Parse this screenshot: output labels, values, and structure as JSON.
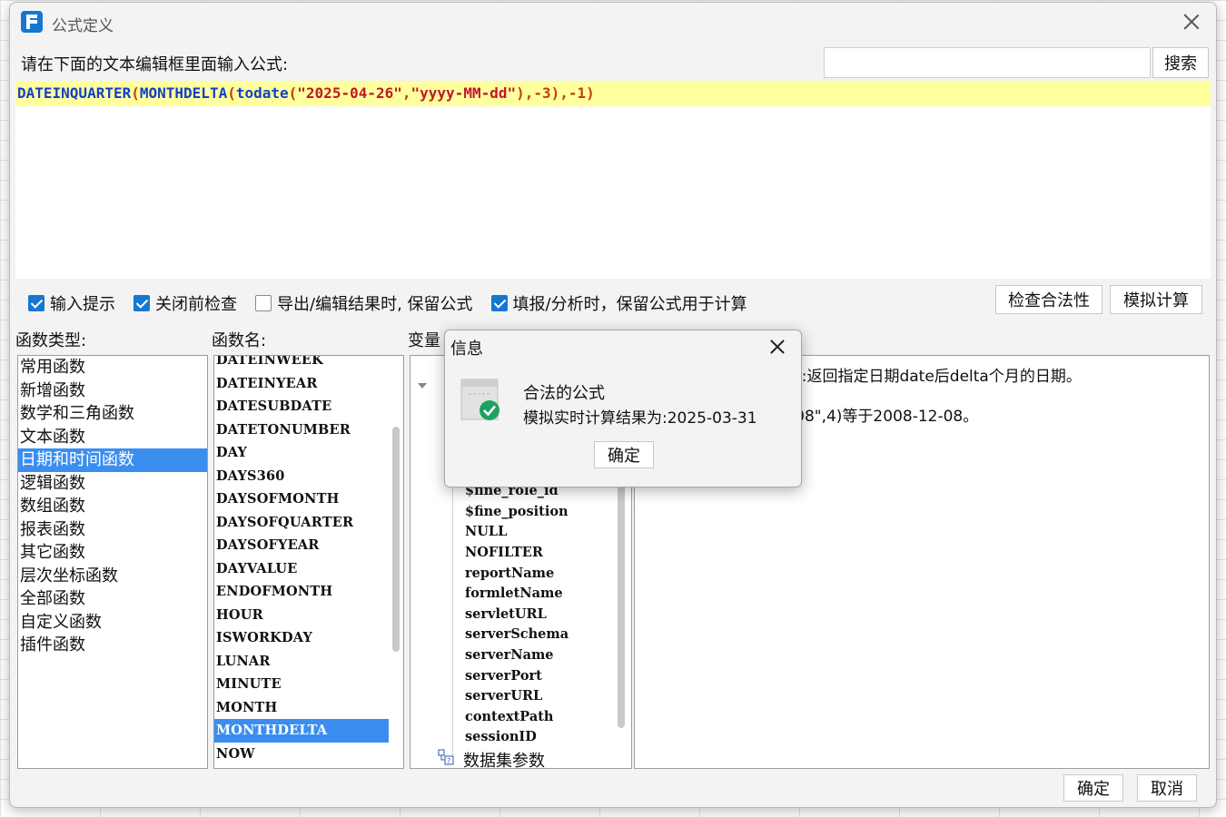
{
  "window": {
    "title": "公式定义",
    "close_label": "×"
  },
  "header": {
    "prompt": "请在下面的文本编辑框里面输入公式:",
    "search_placeholder": "",
    "search_button": "搜索"
  },
  "formula": {
    "text": "DATEINQUARTER(MONTHDELTA(todate(\"2025-04-26\",\"yyyy-MM-dd\"),-3),-1)",
    "tokens": {
      "f1": "DATEINQUARTER",
      "p1": "(",
      "f2": "MONTHDELTA",
      "p2": "(",
      "f3": "todate",
      "p3": "(",
      "s1": "\"2025-04-26\"",
      "c1": ",",
      "s2": "\"yyyy-MM-dd\"",
      "r1": "),-3),-1)"
    }
  },
  "options": [
    {
      "label": "输入提示",
      "checked": true
    },
    {
      "label": "关闭前检查",
      "checked": true
    },
    {
      "label": "导出/编辑结果时, 保留公式",
      "checked": false
    },
    {
      "label": "填报/分析时，保留公式用于计算",
      "checked": true
    }
  ],
  "actions": {
    "check_validity": "检查合法性",
    "simulate": "模拟计算",
    "ok": "确定",
    "cancel": "取消"
  },
  "panels": {
    "category_label": "函数类型:",
    "function_label": "函数名:",
    "variable_label": "变量"
  },
  "categories": [
    "常用函数",
    "新增函数",
    "数学和三角函数",
    "文本函数",
    "日期和时间函数",
    "逻辑函数",
    "数组函数",
    "报表函数",
    "其它函数",
    "层次坐标函数",
    "全部函数",
    "自定义函数",
    "插件函数"
  ],
  "selected_category": "日期和时间函数",
  "functions": [
    "DATEINWEEK",
    "DATEINYEAR",
    "DATESUBDATE",
    "DATETONUMBER",
    "DAY",
    "DAYS360",
    "DAYSOFMONTH",
    "DAYSOFQUARTER",
    "DAYSOFYEAR",
    "DAYVALUE",
    "ENDOFMONTH",
    "HOUR",
    "ISWORKDAY",
    "LUNAR",
    "MINUTE",
    "MONTH",
    "MONTHDELTA",
    "NOW"
  ],
  "selected_function": "MONTHDELTA",
  "variables": [
    "$fine_role_id",
    "$fine_position",
    "NULL",
    "NOFILTER",
    "reportName",
    "formletName",
    "servletURL",
    "serverSchema",
    "serverName",
    "serverPort",
    "serverURL",
    "contextPath",
    "sessionID"
  ],
  "variable_group": "数据集参数",
  "description": {
    "line1": "ta):返回指定日期date后delta个月的日期。",
    "line2": "-08\",4)等于2008-12-08。"
  },
  "popup": {
    "title": "信息",
    "message": "合法的公式",
    "result": "模拟实时计算结果为:2025-03-31",
    "ok": "确定"
  },
  "colors": {
    "accent": "#3b8ef0",
    "formula_highlight": "#ffff9e",
    "function_token": "#1340c8",
    "string_token": "#c0172a"
  }
}
